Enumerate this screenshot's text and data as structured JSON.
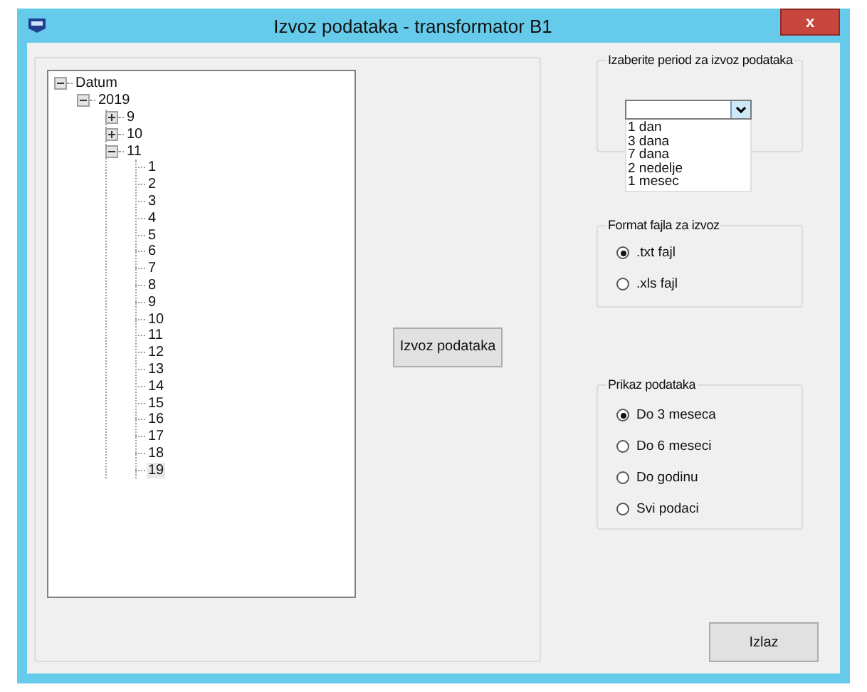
{
  "window": {
    "title": "Izvoz podataka - transformator B1",
    "close": "x"
  },
  "tree": [
    {
      "label": "Datum",
      "expanded": true,
      "selected": false,
      "children": [
        {
          "label": "2019",
          "expanded": true,
          "selected": false,
          "children": [
            {
              "label": "9",
              "expanded": false,
              "selected": false
            },
            {
              "label": "10",
              "expanded": false,
              "selected": false
            },
            {
              "label": "11",
              "expanded": true,
              "selected": false,
              "children": [
                {
                  "label": "1",
                  "selected": false
                },
                {
                  "label": "2",
                  "selected": false
                },
                {
                  "label": "3",
                  "selected": false
                },
                {
                  "label": "4",
                  "selected": false
                },
                {
                  "label": "5",
                  "selected": false
                },
                {
                  "label": "6",
                  "selected": false
                },
                {
                  "label": "7",
                  "selected": false
                },
                {
                  "label": "8",
                  "selected": false
                },
                {
                  "label": "9",
                  "selected": false
                },
                {
                  "label": "10",
                  "selected": false
                },
                {
                  "label": "11",
                  "selected": false
                },
                {
                  "label": "12",
                  "selected": false
                },
                {
                  "label": "13",
                  "selected": false
                },
                {
                  "label": "14",
                  "selected": false
                },
                {
                  "label": "15",
                  "selected": false
                },
                {
                  "label": "16",
                  "selected": false
                },
                {
                  "label": "17",
                  "selected": false
                },
                {
                  "label": "18",
                  "selected": false
                },
                {
                  "label": "19",
                  "selected": true
                }
              ]
            }
          ]
        }
      ]
    }
  ],
  "export_button": "Izvoz podataka",
  "period_group": {
    "title": "Izaberite period za izvoz podataka",
    "options": [
      "1 dan",
      "3 dana",
      "7 dana",
      "2 nedelje",
      "1 mesec"
    ]
  },
  "format_group": {
    "title": "Format fajla za izvoz",
    "options": [
      {
        "label": ".txt fajl",
        "selected": true
      },
      {
        "label": ".xls fajl",
        "selected": false
      }
    ]
  },
  "display_group": {
    "title": "Prikaz podataka",
    "options": [
      {
        "label": "Do 3 meseca",
        "selected": true
      },
      {
        "label": "Do 6 meseci",
        "selected": false
      },
      {
        "label": "Do godinu",
        "selected": false
      },
      {
        "label": "Svi podaci",
        "selected": false
      }
    ]
  },
  "exit_button": "Izlaz"
}
